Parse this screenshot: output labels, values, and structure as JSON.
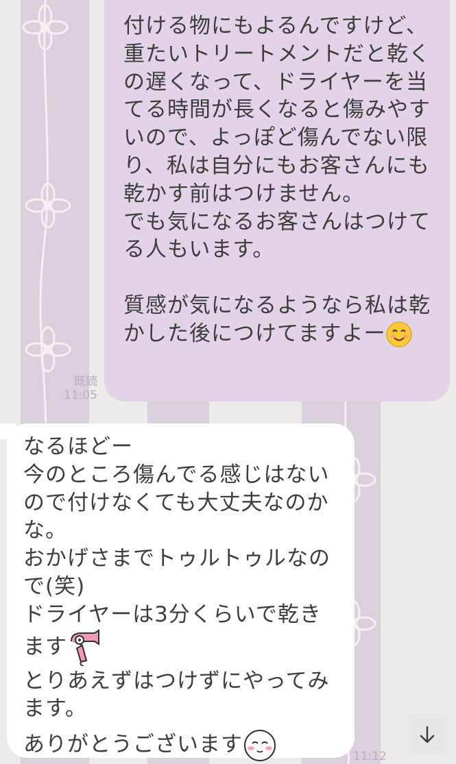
{
  "sent_message": {
    "lines": [
      "付ける物にもよるんですけど、",
      "重たいトリートメントだと乾く",
      "の遅くなって、ドライヤーを当",
      "てる時間が長くなると傷みやす",
      "いので、よっぽど傷んでない限",
      "り、私は自分にもお客さんにも",
      "乾かす前はつけません。",
      "でも気になるお客さんはつけて",
      "る人もいます。",
      "",
      "質感が気になるようなら私は乾",
      "かした後につけてますよー"
    ],
    "read_label": "既読",
    "time": "11:05",
    "end_emoji": "smiling-face-icon"
  },
  "received_message": {
    "lines": [
      "なるほどー",
      "今のところ傷んでる感じはない",
      "ので付けなくても大丈夫なのか",
      "な。",
      "おかげさまでトゥルトゥルなの",
      "で(笑)",
      "ドライヤーは3分くらいで乾き",
      "ます",
      "とりあえずはつけずにやってみ",
      "ます。",
      "ありがとうございます"
    ],
    "time": "11:12",
    "hairdryer_emoji": "hairdryer-icon",
    "end_emoji": "blushing-face-icon"
  },
  "controls": {
    "scroll_down_icon": "arrow-down-icon"
  },
  "colors": {
    "sent_bubble": "#e2d4e6",
    "received_bubble": "#ffffff",
    "wallpaper_light": "#ecebe9",
    "wallpaper_stripe": "#d9d0db",
    "meta_text": "#b9adbd"
  }
}
